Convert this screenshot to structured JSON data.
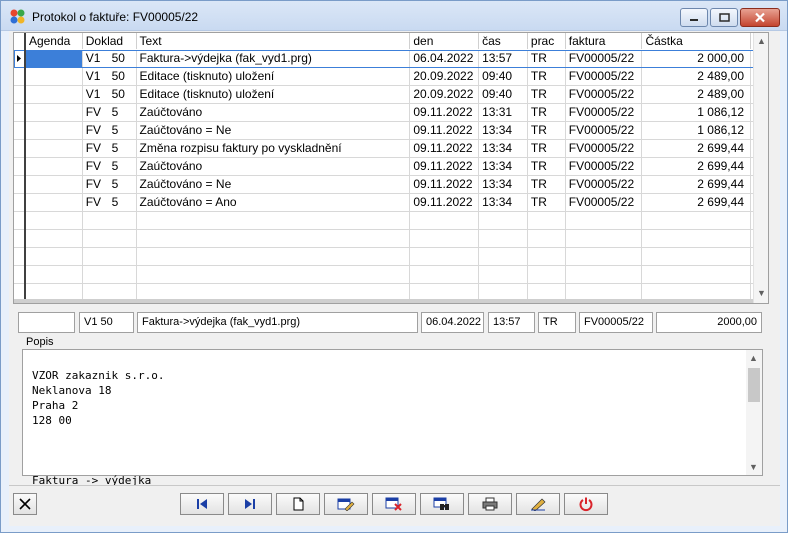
{
  "window": {
    "title": "Protokol o faktuře: FV00005/22"
  },
  "grid": {
    "columns": {
      "agenda": "Agenda",
      "doklad": "Doklad",
      "text": "Text",
      "den": "den",
      "cas": "čas",
      "prac": "prac",
      "faktura": "faktura",
      "castka": "Částka"
    },
    "rows": [
      {
        "agenda": "",
        "dtype": "V1",
        "dnum": "50",
        "text": "Faktura->výdejka (fak_vyd1.prg)",
        "den": "06.04.2022",
        "cas": "13:57",
        "prac": "TR",
        "faktura": "FV00005/22",
        "castka": "2 000,00"
      },
      {
        "agenda": "",
        "dtype": "V1",
        "dnum": "50",
        "text": "Editace (tisknuto) uložení",
        "den": "20.09.2022",
        "cas": "09:40",
        "prac": "TR",
        "faktura": "FV00005/22",
        "castka": "2 489,00"
      },
      {
        "agenda": "",
        "dtype": "V1",
        "dnum": "50",
        "text": "Editace (tisknuto) uložení",
        "den": "20.09.2022",
        "cas": "09:40",
        "prac": "TR",
        "faktura": "FV00005/22",
        "castka": "2 489,00"
      },
      {
        "agenda": "",
        "dtype": "FV",
        "dnum": "5",
        "text": "Zaúčtováno",
        "den": "09.11.2022",
        "cas": "13:31",
        "prac": "TR",
        "faktura": "FV00005/22",
        "castka": "1 086,12"
      },
      {
        "agenda": "",
        "dtype": "FV",
        "dnum": "5",
        "text": "Zaúčtováno = Ne",
        "den": "09.11.2022",
        "cas": "13:34",
        "prac": "TR",
        "faktura": "FV00005/22",
        "castka": "1 086,12"
      },
      {
        "agenda": "",
        "dtype": "FV",
        "dnum": "5",
        "text": "Změna rozpisu faktury po vyskladnění",
        "den": "09.11.2022",
        "cas": "13:34",
        "prac": "TR",
        "faktura": "FV00005/22",
        "castka": "2 699,44"
      },
      {
        "agenda": "",
        "dtype": "FV",
        "dnum": "5",
        "text": "Zaúčtováno",
        "den": "09.11.2022",
        "cas": "13:34",
        "prac": "TR",
        "faktura": "FV00005/22",
        "castka": "2 699,44"
      },
      {
        "agenda": "",
        "dtype": "FV",
        "dnum": "5",
        "text": "Zaúčtováno = Ne",
        "den": "09.11.2022",
        "cas": "13:34",
        "prac": "TR",
        "faktura": "FV00005/22",
        "castka": "2 699,44"
      },
      {
        "agenda": "",
        "dtype": "FV",
        "dnum": "5",
        "text": "Zaúčtováno = Ano",
        "den": "09.11.2022",
        "cas": "13:34",
        "prac": "TR",
        "faktura": "FV00005/22",
        "castka": "2 699,44"
      }
    ]
  },
  "detail": {
    "agenda": "",
    "doklad": "V1   50",
    "text": "Faktura->výdejka (fak_vyd1.prg)",
    "den": "06.04.2022",
    "cas": "13:57",
    "prac": "TR",
    "faktura": "FV00005/22",
    "castka": "2000,00"
  },
  "popis": {
    "label": "Popis",
    "text": "VZOR zakaznik s.r.o.\nNeklanova 18\nPraha 2\n128 00\n\n\n\nFaktura -> výdejka"
  },
  "toolbar": {
    "close_icon": "x-icon",
    "buttons": [
      "first-record-icon",
      "last-record-icon",
      "new-document-icon",
      "edit-icon",
      "delete-icon",
      "find-icon",
      "print-icon",
      "pencil-icon",
      "power-icon"
    ]
  },
  "colors": {
    "selection": "#3c7fd9",
    "nav_blue": "#1b3fa6",
    "power_red": "#d9242b"
  }
}
